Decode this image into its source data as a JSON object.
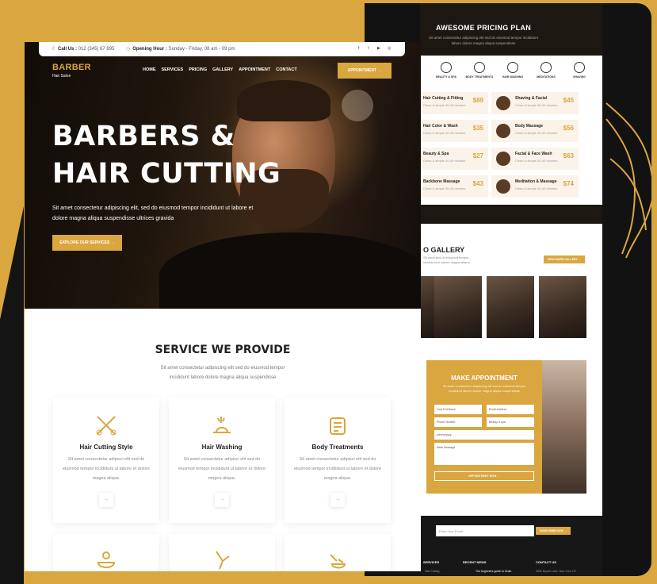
{
  "colors": {
    "gold": "#d9a640",
    "dark": "#121212"
  },
  "topbar": {
    "call_label": "Call Us :",
    "call_value": "012 (345) 67 895",
    "hours_label": "Opening Hour :",
    "hours_value": "Sunday - Friday, 08 am - 09 pm",
    "social_icons": [
      "facebook-icon",
      "twitter-icon",
      "youtube-icon",
      "whatsapp-icon"
    ]
  },
  "logo": {
    "title": "BARBER",
    "subtitle": "Hair Salon"
  },
  "nav": {
    "items": [
      "HOME",
      "SERVICES",
      "PRICING",
      "GALLERY",
      "APPOINTMENT",
      "CONTACT"
    ]
  },
  "header_button": "APPOINTMENT →",
  "hero": {
    "title_line1": "BARBERS &",
    "title_line2": "HAIR CUTTING",
    "text": "Sit amet consectetur adipiscing elit, sed do eiusmod tempor incididunt ut labore et dolore magna aliqua suspendisse ultrices gravida",
    "button": "EXPLORE OUR SERVICES →"
  },
  "services": {
    "title": "SERVICE WE PROVIDE",
    "subtitle": "Sit amet consectetur adipiscing elit sed do eiusmod tempor incididunt labore dolore magna aliqua suspendisse",
    "cards": [
      {
        "icon": "scissors-comb-icon",
        "name": "Hair Cutting Style",
        "desc": "Sit amet consectetur adipisci elit sed do eiusmod tempor incididunt ut labore et dolore magna aliqua."
      },
      {
        "icon": "hair-wash-icon",
        "name": "Hair Washing",
        "desc": "Sit amet consectetur adipisci elit sed do eiusmod tempor incididunt ut labore et dolore magna aliqua."
      },
      {
        "icon": "treatment-icon",
        "name": "Body Treatments",
        "desc": "Sit amet consectetur adipisci elit sed do eiusmod tempor incididunt ut labore et dolore magna aliqua."
      }
    ],
    "arrow": "→",
    "more_icons": [
      "herbal-bowl-icon",
      "razor-icon",
      "shaving-brush-icon"
    ]
  },
  "pricing": {
    "title": "AWESOME PRICING PLAN",
    "subtitle": "Sit amet consectetur adipiscing elit sed do eiusmod tempor incididunt labore dolore magna aliqua suspendisse",
    "categories": [
      "BEAUTY & SPA",
      "BODY TREATMENTS",
      "HAIR WASHING",
      "MEDITATIONS",
      "SHAVING"
    ],
    "items": [
      {
        "name": "Hair Cutting & Fitting",
        "desc": "Clean & simple 30-40 minutes",
        "price": "$89"
      },
      {
        "name": "Shaving & Facial",
        "desc": "Clean & simple 30-40 minutes",
        "price": "$45"
      },
      {
        "name": "Hair Color & Wash",
        "desc": "Clean & simple 30-40 minutes",
        "price": "$35"
      },
      {
        "name": "Body Massage",
        "desc": "Clean & simple 30-40 minutes",
        "price": "$56"
      },
      {
        "name": "Beauty & Spa",
        "desc": "Clean & simple 30-40 minutes",
        "price": "$27"
      },
      {
        "name": "Facial & Face Wash",
        "desc": "Clean & simple 30-40 minutes",
        "price": "$63"
      },
      {
        "name": "Backbone Massage",
        "desc": "Clean & simple 30-40 minutes",
        "price": "$43"
      },
      {
        "name": "Meditation & Massage",
        "desc": "Clean & simple 30-40 minutes",
        "price": "$74"
      }
    ]
  },
  "gallery": {
    "title": "O GALLERY",
    "subtitle": "Sit amet sed do eiusmod tempor incididunt ut labore magna aliqua",
    "button": "VIEW MORE GALLERY →"
  },
  "appointment": {
    "title": "MAKE APPOINTMENT",
    "subtitle": "Sit amet consectetur adipiscing elit sed do eiusmod tempor incididunt labore dolore magna aliqua suspendisse",
    "fields": {
      "name": "Your Full Name",
      "email": "Email Address",
      "phone": "Phone Number",
      "service": "Beauty & spa",
      "date": "dd/mm/yyyy",
      "message": "Write Message"
    },
    "button": "APPOINTMENT NOW →"
  },
  "footer": {
    "newsletter_placeholder": "Enter Your Email",
    "newsletter_button": "SUBSCRIBE NOW →",
    "columns": [
      "SERVICES",
      "RECENT NEWS",
      "CONTACT US"
    ],
    "service_item": "Hair Cutting",
    "news_item": "The beginners guide to Grain",
    "contact_item": "3536 Bryant Lane, New York, NY"
  }
}
